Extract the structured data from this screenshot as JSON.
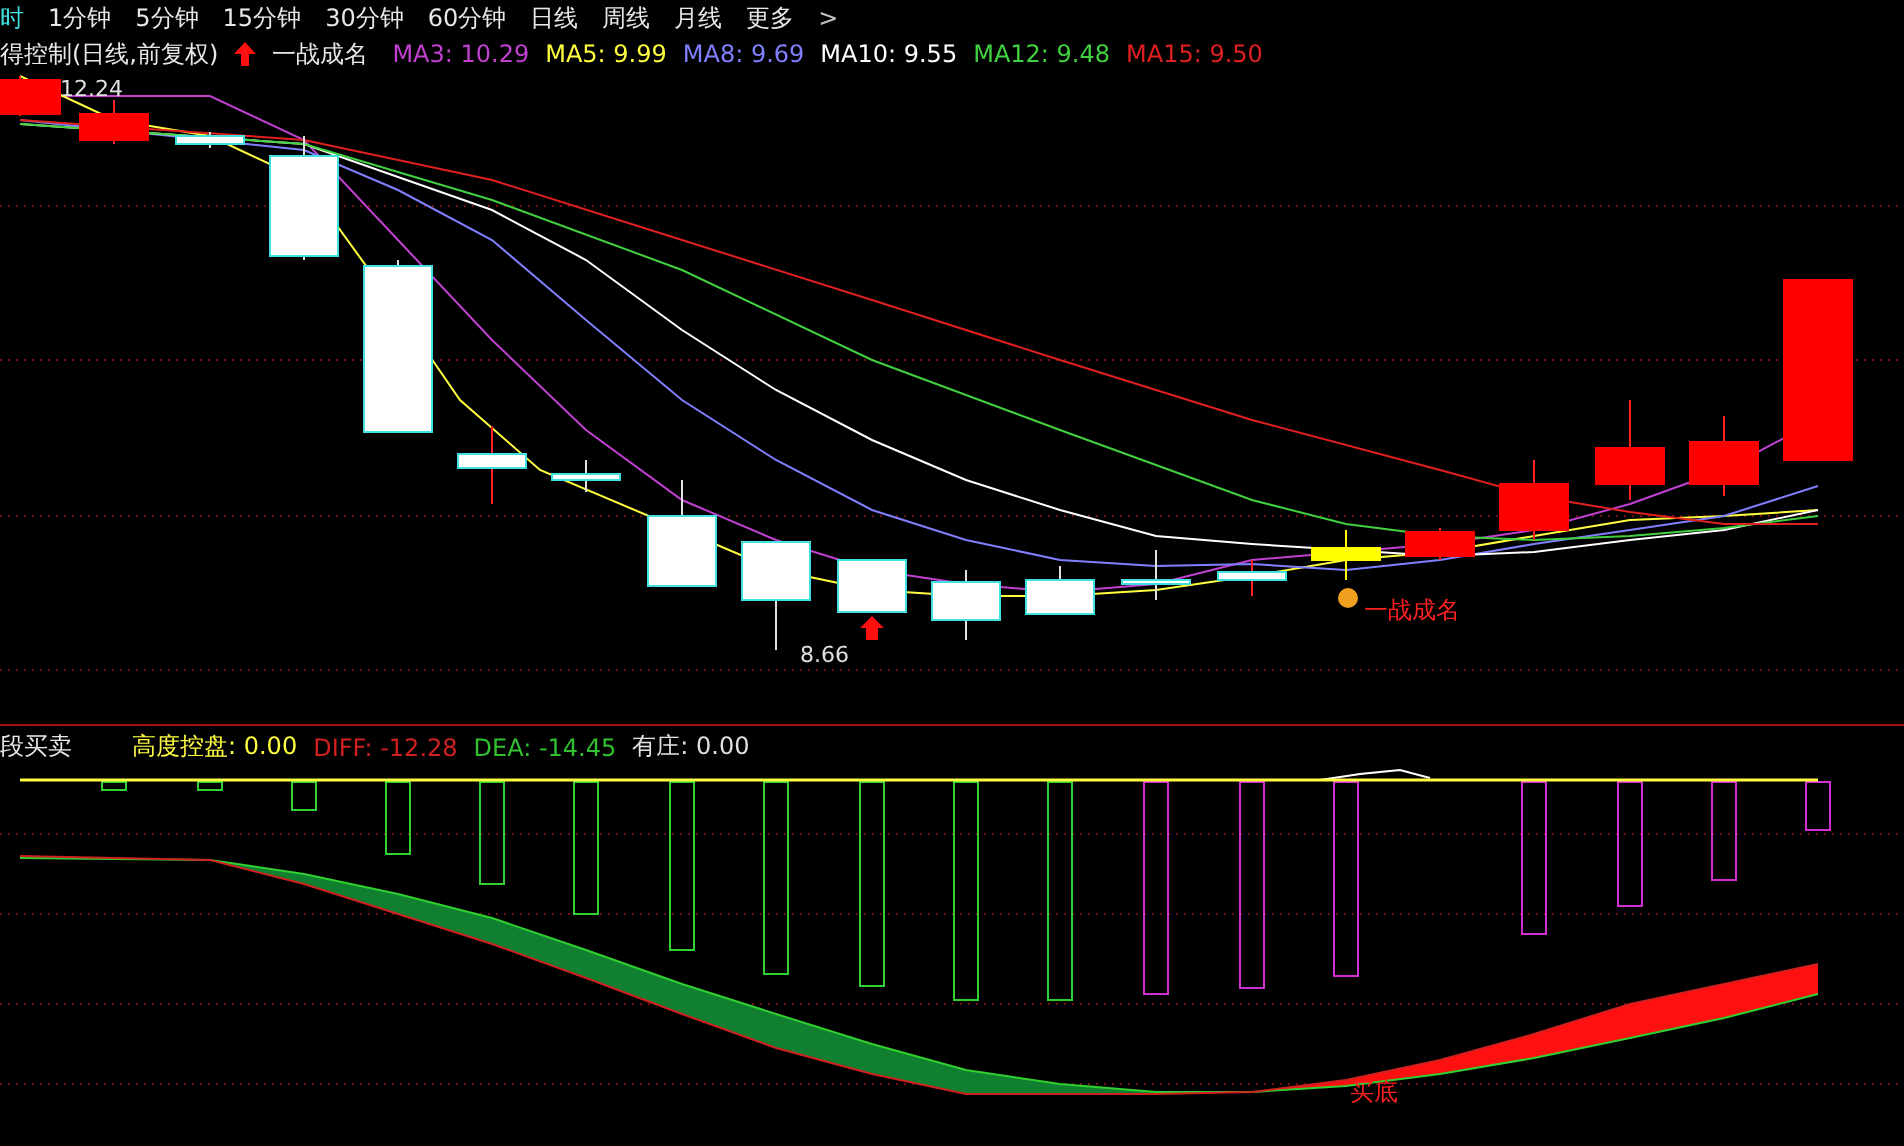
{
  "timeframe_tabs": [
    {
      "label": "时",
      "selected": true
    },
    {
      "label": "1分钟",
      "selected": false
    },
    {
      "label": "5分钟",
      "selected": false
    },
    {
      "label": "15分钟",
      "selected": false
    },
    {
      "label": "30分钟",
      "selected": false
    },
    {
      "label": "60分钟",
      "selected": false
    },
    {
      "label": "日线",
      "selected": false
    },
    {
      "label": "周线",
      "selected": false
    },
    {
      "label": "月线",
      "selected": false
    },
    {
      "label": "更多",
      "selected": false
    }
  ],
  "more_chevron": ">",
  "main_legend": {
    "title": "得控制(日线,前复权)",
    "signal_name": "一战成名",
    "indicators": [
      {
        "label": "MA3: 10.29",
        "color": "#c040d0"
      },
      {
        "label": "MA5: 9.99",
        "color": "#ffff40"
      },
      {
        "label": "MA8: 9.69",
        "color": "#8080ff"
      },
      {
        "label": "MA10: 9.55",
        "color": "#ffffff"
      },
      {
        "label": "MA12: 9.48",
        "color": "#40d040"
      },
      {
        "label": "MA15: 9.50",
        "color": "#e02020"
      }
    ]
  },
  "main_chart": {
    "high_label": "12.24",
    "low_label": "8.66",
    "signal_label": "一战成名"
  },
  "lower_legend": {
    "title": "段买卖",
    "indicators": [
      {
        "label": "高度控盘: 0.00",
        "color": "#ffff40"
      },
      {
        "label": "DIFF: -12.28",
        "color": "#d02020"
      },
      {
        "label": "DEA: -14.45",
        "color": "#30c030"
      },
      {
        "label": "有庄: 0.00",
        "color": "#e0e0e0"
      }
    ]
  },
  "lower_chart": {
    "signal_label": "买底"
  }
}
